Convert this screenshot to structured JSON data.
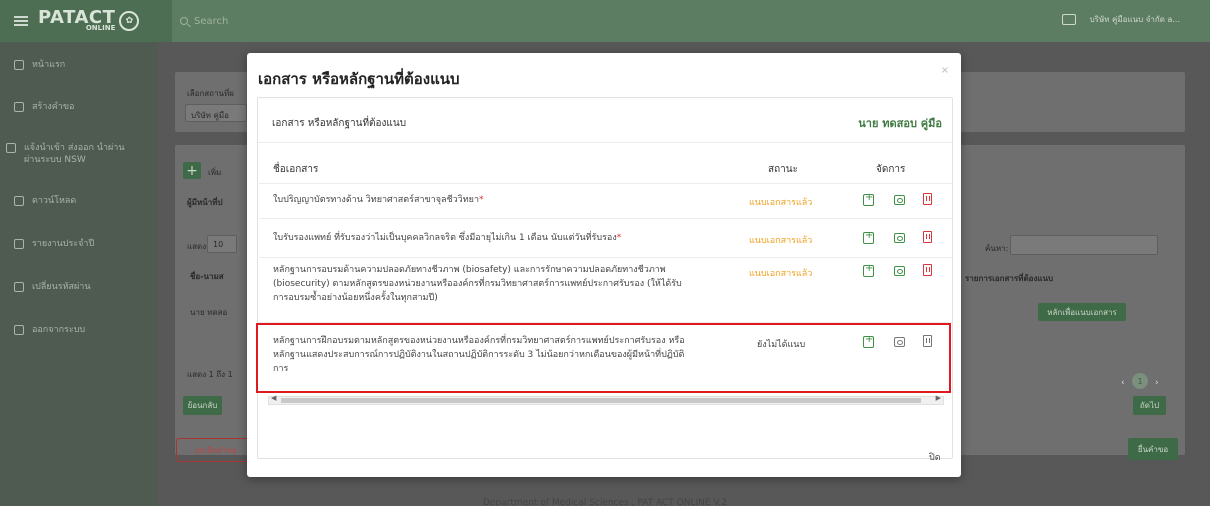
{
  "app": {
    "logo_main": "PATACT",
    "logo_sub": "ONLINE",
    "search_placeholder": "Search",
    "user_name": "บริษัท คู่มือแนบ จำกัด a..."
  },
  "sidebar": {
    "items": [
      {
        "label": "หน้าแรก",
        "icon": "home-icon"
      },
      {
        "label": "สร้างคำขอ",
        "icon": "pencil-icon"
      },
      {
        "label": "แจ้งนำเข้า ส่งออก นำผ่าน ผ่านระบบ NSW",
        "icon": "plane-icon"
      },
      {
        "label": "ดาวน์โหลด",
        "icon": "download-icon"
      },
      {
        "label": "รายงานประจำปี",
        "icon": "file-icon"
      },
      {
        "label": "เปลี่ยนรหัสผ่าน",
        "icon": "cogs-icon"
      },
      {
        "label": "ออกจากระบบ",
        "icon": "logout-icon"
      }
    ]
  },
  "background": {
    "select_location_label": "เลือกสถานที่ผ",
    "company_value": "บริษัท คู่มือ",
    "add_label": "เพิ่ม",
    "responsible_header": "ผู้มีหน้าที่ป",
    "show_label": "แสดง",
    "show_count": "10",
    "col_name": "ชื่อ-นามส",
    "row_name": "นาย ทดสอ",
    "showing_text": "แสดง 1 ถึง 1",
    "search_label": "ค้นหา:",
    "col_docs": "รายการเอกสารที่ต้องแนบ",
    "attach_btn": "หลักเพื่อแนบเอกสาร",
    "page_current": "1",
    "back_btn": "ย้อนกลับ",
    "next_btn": "ถัดไป",
    "cancel_btn": "ยกเลิกคำขอ",
    "submit_btn": "ยื่นคำขอ",
    "footer": "Department of Medical Sciences , PAT ACT ONLINE V.2"
  },
  "modal": {
    "title": "เอกสาร หรือหลักฐานที่ต้องแนบ",
    "panel_title": "เอกสาร หรือหลักฐานที่ต้องแนบ",
    "person_name": "นาย ทดสอบ คู่มือ",
    "col_doc_name": "ชื่อเอกสาร",
    "col_status": "สถานะ",
    "col_manage": "จัดการ",
    "rows": [
      {
        "lines": [
          "ใบปริญญาบัตรทางด้าน วิทยาศาสตร์สาขาจุลชีววิทยา"
        ],
        "required": true,
        "status": "แนบเอกสารแล้ว",
        "attached": true
      },
      {
        "lines": [
          "ใบรับรองแพทย์ ที่รับรองว่าไม่เป็นบุคคลวิกลจริต ซึ่งมีอายุไม่เกิน 1 เดือน นับแต่วันที่รับรอง"
        ],
        "required": true,
        "status": "แนบเอกสารแล้ว",
        "attached": true
      },
      {
        "lines": [
          "หลักฐานการอบรมด้านความปลอดภัยทางชีวภาพ (biosafety) และการรักษาความปลอดภัยทางชีวภาพ",
          "(biosecurity) ตามหลักสูตรของหน่วยงานหรือองค์กรที่กรมวิทยาศาสตร์การแพทย์ประกาศรับรอง (ให้ได้รับ",
          "การอบรมซ้ำอย่างน้อยหนึ่งครั้งในทุกสามปี)"
        ],
        "required": false,
        "status": "แนบเอกสารแล้ว",
        "attached": true
      },
      {
        "lines": [
          "หลักฐานการฝึกอบรมตามหลักสูตรของหน่วยงานหรือองค์กรที่กรมวิทยาศาสตร์การแพทย์ประกาศรับรอง หรือ",
          "หลักฐานแสดงประสบการณ์การปฏิบัติงานในสถานปฏิบัติการระดับ 3 ไม่น้อยกว่าหกเดือนของผู้มีหน้าที่ปฏิบัติ",
          "การ"
        ],
        "required": false,
        "status": "ยังไม่ได้แนบ",
        "attached": false
      }
    ],
    "close_label": "ปิด",
    "colors": {
      "attached": "#f0a020",
      "highlight": "#e0191f",
      "accent": "#3e7a41"
    }
  }
}
